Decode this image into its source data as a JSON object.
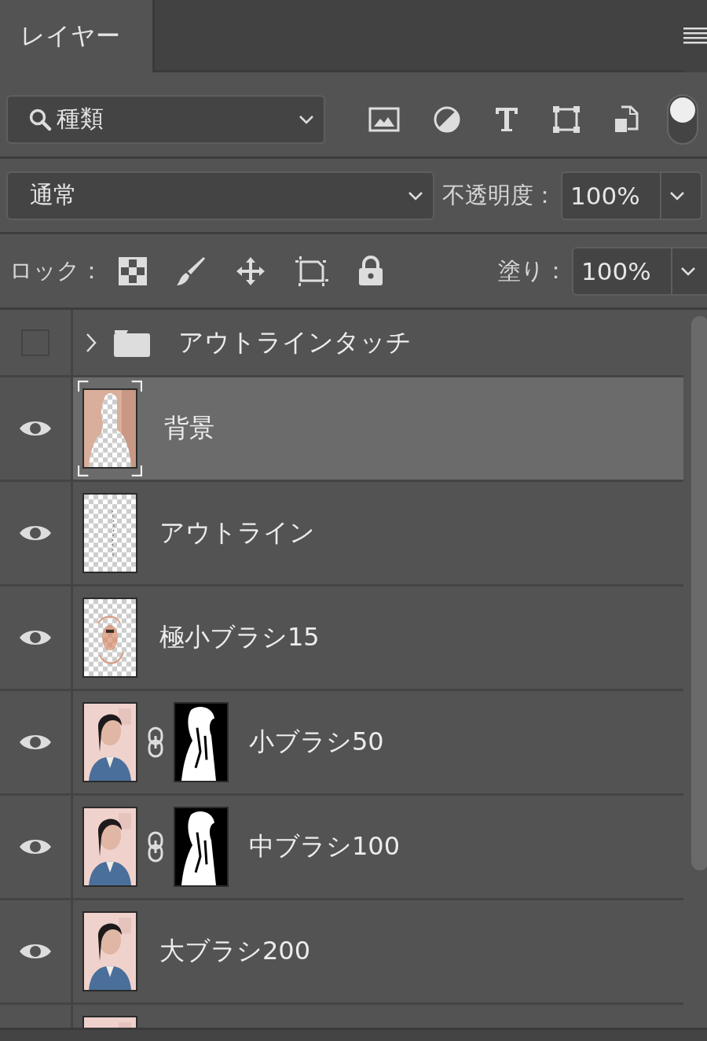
{
  "panel": {
    "tab": "レイヤー"
  },
  "filter": {
    "label": "種類"
  },
  "blend": {
    "value": "通常",
    "opacity_label": "不透明度：",
    "opacity": "100%"
  },
  "lock": {
    "label": "ロック：",
    "fill_label": "塗り：",
    "fill": "100%"
  },
  "layers": [
    {
      "kind": "group",
      "name": "アウトラインタッチ",
      "visible": false,
      "expanded": false,
      "selected": false
    },
    {
      "kind": "layer",
      "name": "背景",
      "visible": true,
      "selected": true,
      "mask": false
    },
    {
      "kind": "layer",
      "name": "アウトライン",
      "visible": true,
      "selected": false,
      "mask": false
    },
    {
      "kind": "layer",
      "name": "極小ブラシ15",
      "visible": true,
      "selected": false,
      "mask": false
    },
    {
      "kind": "layer",
      "name": "小ブラシ50",
      "visible": true,
      "selected": false,
      "mask": true
    },
    {
      "kind": "layer",
      "name": "中ブラシ100",
      "visible": true,
      "selected": false,
      "mask": true
    },
    {
      "kind": "layer",
      "name": "大ブラシ200",
      "visible": true,
      "selected": false,
      "mask": false
    },
    {
      "kind": "layer"
    }
  ]
}
